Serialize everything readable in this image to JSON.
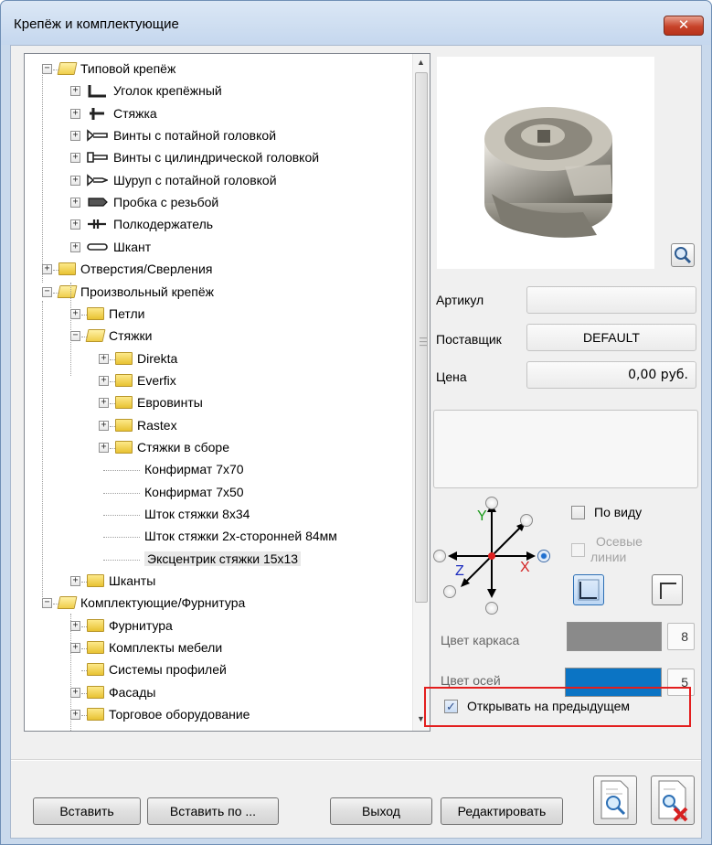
{
  "window": {
    "title": "Крепёж и комплектующие",
    "close_glyph": "✕"
  },
  "tree": {
    "nodes": [
      {
        "label": "Типовой крепёж",
        "expander": "−",
        "icon": "folder-open-icon"
      },
      {
        "label": "Уголок крепёжный",
        "expander": "+",
        "icon": "angle-bracket-icon"
      },
      {
        "label": "Стяжка",
        "expander": "+",
        "icon": "tie-icon"
      },
      {
        "label": "Винты с потайной головкой",
        "expander": "+",
        "icon": "countersunk-screw-icon"
      },
      {
        "label": "Винты с цилиндрической головкой",
        "expander": "+",
        "icon": "cylinder-screw-icon"
      },
      {
        "label": "Шуруп с потайной головкой",
        "expander": "+",
        "icon": "wood-screw-icon"
      },
      {
        "label": "Пробка с резьбой",
        "expander": "+",
        "icon": "threaded-plug-icon"
      },
      {
        "label": "Полкодержатель",
        "expander": "+",
        "icon": "shelf-support-icon"
      },
      {
        "label": "Шкант",
        "expander": "+",
        "icon": "dowel-icon"
      },
      {
        "label": "Отверстия/Сверления",
        "expander": "+",
        "icon": "folder-icon"
      },
      {
        "label": "Произвольный крепёж",
        "expander": "−",
        "icon": "folder-open-icon"
      },
      {
        "label": "Петли",
        "expander": "+",
        "icon": "folder-icon"
      },
      {
        "label": "Стяжки",
        "expander": "−",
        "icon": "folder-open-icon"
      },
      {
        "label": "Direkta",
        "expander": "+",
        "icon": "folder-icon"
      },
      {
        "label": "Everfix",
        "expander": "+",
        "icon": "folder-icon"
      },
      {
        "label": "Евровинты",
        "expander": "+",
        "icon": "folder-icon"
      },
      {
        "label": "Rastex",
        "expander": "+",
        "icon": "folder-icon"
      },
      {
        "label": "Стяжки в сборе",
        "expander": "+",
        "icon": "folder-icon"
      },
      {
        "label": "Конфирмат 7х70",
        "expander": "",
        "icon": ""
      },
      {
        "label": "Конфирмат 7х50",
        "expander": "",
        "icon": ""
      },
      {
        "label": "Шток стяжки 8х34",
        "expander": "",
        "icon": ""
      },
      {
        "label": "Шток стяжки 2х-сторонней 84мм",
        "expander": "",
        "icon": ""
      },
      {
        "label": "Эксцентрик стяжки 15х13",
        "expander": "",
        "icon": ""
      },
      {
        "label": "Шканты",
        "expander": "+",
        "icon": "folder-icon"
      },
      {
        "label": "Комплектующие/Фурнитура",
        "expander": "−",
        "icon": "folder-open-icon"
      },
      {
        "label": "Фурнитура",
        "expander": "+",
        "icon": "folder-icon"
      },
      {
        "label": "Комплекты мебели",
        "expander": "+",
        "icon": "folder-icon"
      },
      {
        "label": "Системы профилей",
        "expander": "",
        "icon": "folder-icon"
      },
      {
        "label": "Фасады",
        "expander": "+",
        "icon": "folder-icon"
      },
      {
        "label": "Торговое оборудование",
        "expander": "+",
        "icon": "folder-icon"
      }
    ],
    "selected": "Эксцентрик стяжки 15х13"
  },
  "details": {
    "article_label": "Артикул",
    "article_value": "",
    "supplier_label": "Поставщик",
    "supplier_value": "DEFAULT",
    "price_label": "Цена",
    "price_value": "0,00 руб."
  },
  "view": {
    "by_view_label": "По виду",
    "by_view_checked": false,
    "axis_lines_label_1": "Осевые",
    "axis_lines_label_2": "линии",
    "axis_lines_checked": false,
    "axis_y": "Y",
    "axis_x": "X",
    "axis_z": "Z"
  },
  "colors": {
    "frame_label": "Цвет каркаса",
    "frame_color": "#8a8a8a",
    "frame_value": "8",
    "axes_label": "Цвет осей",
    "axes_color": "#0b74c4",
    "axes_value": "5"
  },
  "remember": {
    "label": "Открывать на предыдущем",
    "checked": true
  },
  "buttons": {
    "insert": "Вставить",
    "insert_by": "Вставить по ...",
    "exit": "Выход",
    "edit": "Редактировать"
  }
}
